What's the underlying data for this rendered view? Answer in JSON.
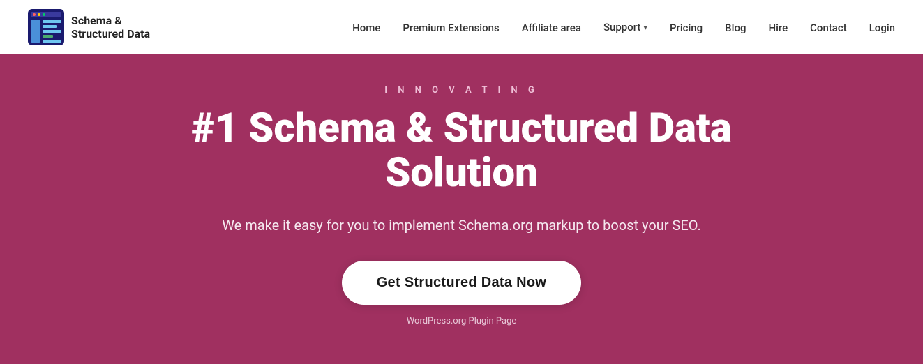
{
  "logo": {
    "text_line1": "Schema &",
    "text_line2": "Structured Data"
  },
  "nav": {
    "items": [
      {
        "label": "Home",
        "has_dropdown": false
      },
      {
        "label": "Premium Extensions",
        "has_dropdown": false
      },
      {
        "label": "Affiliate area",
        "has_dropdown": false
      },
      {
        "label": "Support",
        "has_dropdown": true
      },
      {
        "label": "Pricing",
        "has_dropdown": false
      },
      {
        "label": "Blog",
        "has_dropdown": false
      },
      {
        "label": "Hire",
        "has_dropdown": false
      },
      {
        "label": "Contact",
        "has_dropdown": false
      },
      {
        "label": "Login",
        "has_dropdown": false
      }
    ]
  },
  "hero": {
    "tagline": "I N N O V A T I N G",
    "title": "#1 Schema & Structured Data Solution",
    "subtitle": "We make it easy for you to implement Schema.org markup to boost your SEO.",
    "cta_label": "Get Structured Data Now",
    "footer_link": "WordPress.org Plugin Page"
  },
  "colors": {
    "background": "#a03060",
    "header_bg": "#ffffff",
    "cta_bg": "#ffffff",
    "cta_text": "#1a1a1a",
    "hero_text": "#ffffff"
  }
}
